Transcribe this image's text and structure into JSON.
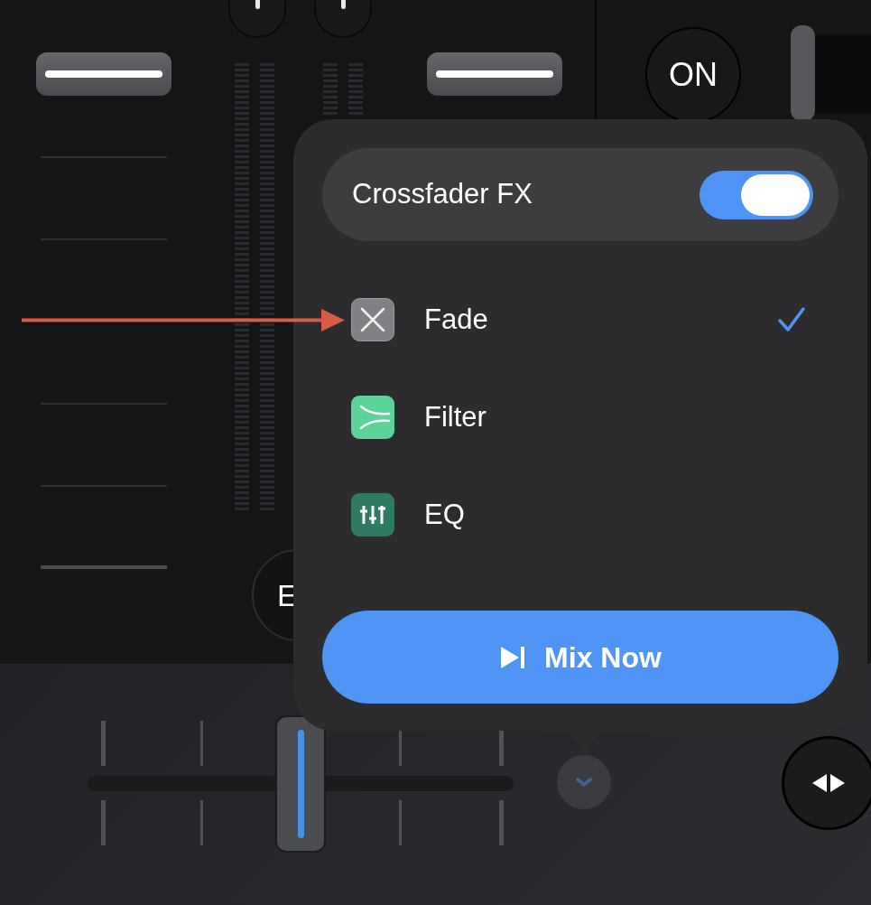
{
  "mixer": {
    "on_button": "ON",
    "partial_button": "E",
    "crossfader": {
      "level": 0.5
    }
  },
  "popover": {
    "toggle": {
      "label": "Crossfader FX",
      "on": true
    },
    "options": [
      {
        "label": "Fade",
        "kind": "fade",
        "selected": true
      },
      {
        "label": "Filter",
        "kind": "filter",
        "selected": false
      },
      {
        "label": "EQ",
        "kind": "eq",
        "selected": false
      }
    ],
    "button": "Mix Now"
  }
}
